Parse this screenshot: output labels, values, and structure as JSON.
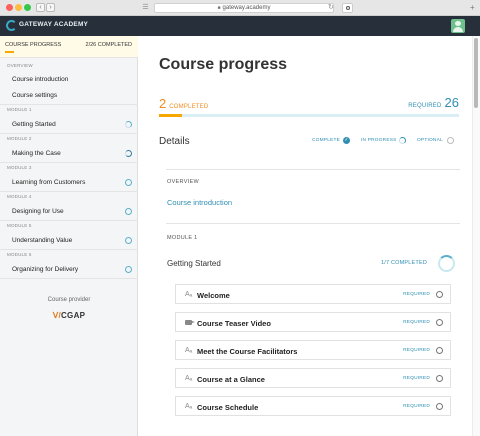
{
  "browser": {
    "url": "gateway.academy",
    "nav_back": "‹",
    "nav_fwd": "›",
    "sidebar_icon": "sidebar-icon",
    "reload_icon": "reload-icon",
    "reload_glyph": "↻",
    "new_tab_glyph": "+"
  },
  "header": {
    "brand": "GATEWAY ACADEMY",
    "user_icon": "user-icon"
  },
  "sidebar": {
    "title": "COURSE PROGRESS",
    "count": "2/26 COMPLETED",
    "overview_label": "OVERVIEW",
    "overview_items": [
      {
        "label": "Course introduction"
      },
      {
        "label": "Course settings"
      }
    ],
    "modules": [
      {
        "label": "MODULE 1",
        "title": "Getting Started",
        "status": "in-progress"
      },
      {
        "label": "MODULE 2",
        "title": "Making the Case",
        "status": "half"
      },
      {
        "label": "MODULE 3",
        "title": "Learning from Customers",
        "status": "optional"
      },
      {
        "label": "MODULE 4",
        "title": "Designing for Use",
        "status": "optional"
      },
      {
        "label": "MODULE 5",
        "title": "Understanding Value",
        "status": "optional"
      },
      {
        "label": "MODULE 6",
        "title": "Organizing for Delivery",
        "status": "optional"
      }
    ],
    "provider_label": "Course provider",
    "provider_name": "CGAP",
    "provider_mark": "ᐯ/"
  },
  "main": {
    "title": "Course progress",
    "completed_num": "2",
    "completed_label": "COMPLETED",
    "required_label": "REQUIRED",
    "required_num": "26",
    "progress_fraction": 0.077,
    "details_title": "Details",
    "legend": {
      "complete": "COMPLETE",
      "in_progress": "IN PROGRESS",
      "optional": "OPTIONAL",
      "check": "✓"
    },
    "overview_label": "OVERVIEW",
    "overview_link": "Course introduction",
    "module_label": "MODULE 1",
    "module_name": "Getting Started",
    "module_progress": "1/7 COMPLETED",
    "lessons": [
      {
        "icon": "text-icon",
        "glyph": "Aₐ",
        "name": "Welcome",
        "status": "REQUIRED"
      },
      {
        "icon": "video-icon",
        "glyph": "",
        "name": "Course Teaser Video",
        "status": "REQUIRED"
      },
      {
        "icon": "text-icon",
        "glyph": "Aₐ",
        "name": "Meet the Course Facilitators",
        "status": "REQUIRED"
      },
      {
        "icon": "text-icon",
        "glyph": "Aₐ",
        "name": "Course at a Glance",
        "status": "REQUIRED"
      },
      {
        "icon": "text-icon",
        "glyph": "Aₐ",
        "name": "Course Schedule",
        "status": "REQUIRED"
      }
    ]
  },
  "colors": {
    "accent": "#2f8fb3",
    "highlight": "#f28c1e",
    "header_bg": "#272f3a"
  }
}
